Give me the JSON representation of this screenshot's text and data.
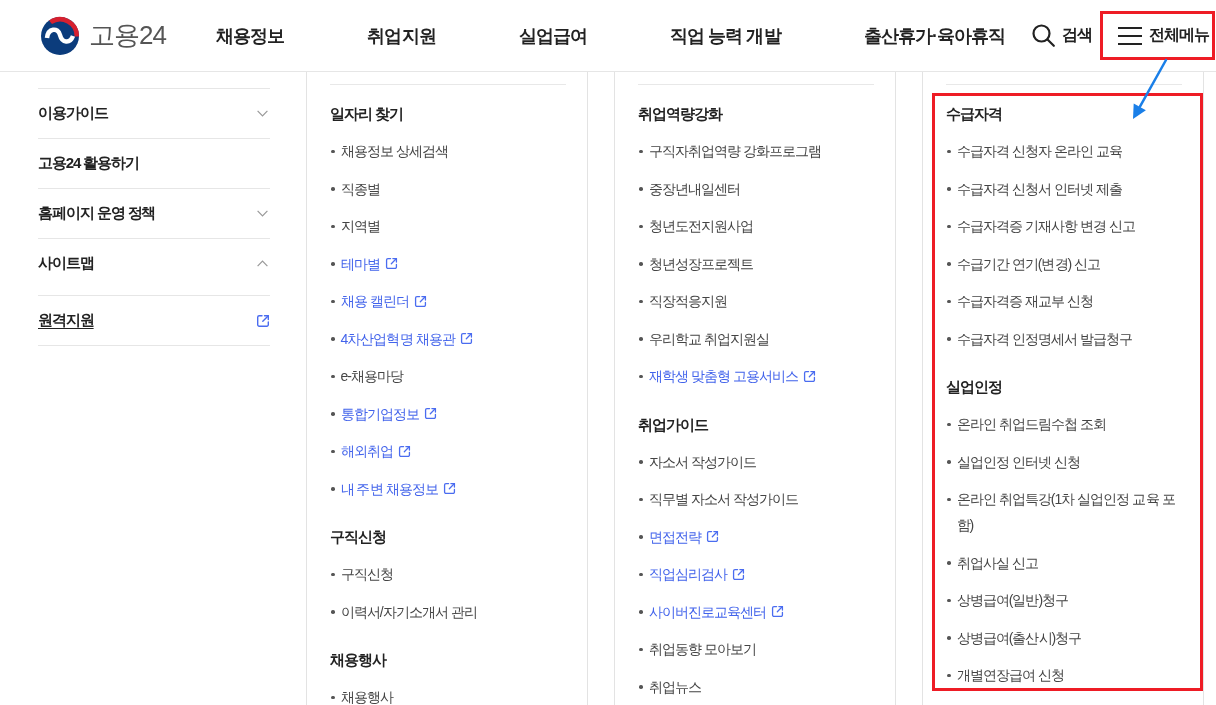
{
  "header": {
    "logo_text": "고용24",
    "nav": [
      "채용정보",
      "취업지원",
      "실업급여",
      "직업 능력 개발",
      "출산휴가·육아휴직"
    ],
    "search": {
      "label": "검색"
    },
    "all_menu": {
      "label": "전체메뉴",
      "highlighted": true
    }
  },
  "sidebar": {
    "items": [
      {
        "label": "이용가이드",
        "kind": "toggle",
        "expanded": false
      },
      {
        "label": "고용24 활용하기",
        "kind": "plain"
      },
      {
        "label": "홈페이지 운영 정책",
        "kind": "toggle",
        "expanded": false
      },
      {
        "label": "사이트맵",
        "kind": "toggle",
        "expanded": true
      },
      {
        "label": "원격지원",
        "kind": "external"
      }
    ]
  },
  "columns": [
    {
      "highlighted": false,
      "sections": [
        {
          "title": "일자리 찾기",
          "items": [
            {
              "label": "채용정보 상세검색",
              "external": false
            },
            {
              "label": "직종별",
              "external": false
            },
            {
              "label": "지역별",
              "external": false
            },
            {
              "label": "테마별",
              "external": true
            },
            {
              "label": "채용 캘린더",
              "external": true
            },
            {
              "label": "4차산업혁명 채용관",
              "external": true
            },
            {
              "label": "e-채용마당",
              "external": false
            },
            {
              "label": "통합기업정보",
              "external": true
            },
            {
              "label": "해외취업",
              "external": true
            },
            {
              "label": "내 주변 채용정보",
              "external": true
            }
          ]
        },
        {
          "title": "구직신청",
          "items": [
            {
              "label": "구직신청",
              "external": false
            },
            {
              "label": "이력서/자기소개서 관리",
              "external": false
            }
          ]
        },
        {
          "title": "채용행사",
          "items": [
            {
              "label": "채용행사",
              "external": false
            }
          ]
        }
      ]
    },
    {
      "highlighted": false,
      "sections": [
        {
          "title": "취업역량강화",
          "items": [
            {
              "label": "구직자취업역량 강화프로그램",
              "external": false
            },
            {
              "label": "중장년내일센터",
              "external": false
            },
            {
              "label": "청년도전지원사업",
              "external": false
            },
            {
              "label": "청년성장프로젝트",
              "external": false
            },
            {
              "label": "직장적응지원",
              "external": false
            },
            {
              "label": "우리학교 취업지원실",
              "external": false
            },
            {
              "label": "재학생 맞춤형 고용서비스",
              "external": true
            }
          ]
        },
        {
          "title": "취업가이드",
          "items": [
            {
              "label": "자소서 작성가이드",
              "external": false
            },
            {
              "label": "직무별 자소서 작성가이드",
              "external": false
            },
            {
              "label": "면접전략",
              "external": true
            },
            {
              "label": "직업심리검사",
              "external": true
            },
            {
              "label": "사이버진로교육센터",
              "external": true
            },
            {
              "label": "취업동향 모아보기",
              "external": false
            },
            {
              "label": "취업뉴스",
              "external": false
            }
          ]
        }
      ]
    },
    {
      "highlighted": true,
      "sections": [
        {
          "title": "수급자격",
          "items": [
            {
              "label": "수급자격 신청자 온라인 교육",
              "external": false
            },
            {
              "label": "수급자격 신청서 인터넷 제출",
              "external": false
            },
            {
              "label": "수급자격증 기재사항 변경 신고",
              "external": false
            },
            {
              "label": "수급기간 연기(변경) 신고",
              "external": false
            },
            {
              "label": "수급자격증 재교부 신청",
              "external": false
            },
            {
              "label": "수급자격 인정명세서 발급청구",
              "external": false
            }
          ]
        },
        {
          "title": "실업인정",
          "items": [
            {
              "label": "온라인 취업드림수첩 조회",
              "external": false
            },
            {
              "label": "실업인정 인터넷 신청",
              "external": false
            },
            {
              "label": "온라인 취업특강(1차 실업인정 교육 포함)",
              "external": false
            },
            {
              "label": "취업사실 신고",
              "external": false
            },
            {
              "label": "상병급여(일반)청구",
              "external": false
            },
            {
              "label": "상병급여(출산시)청구",
              "external": false
            },
            {
              "label": "개별연장급여 신청",
              "external": false
            }
          ]
        }
      ]
    }
  ],
  "annotation_arrow": true
}
